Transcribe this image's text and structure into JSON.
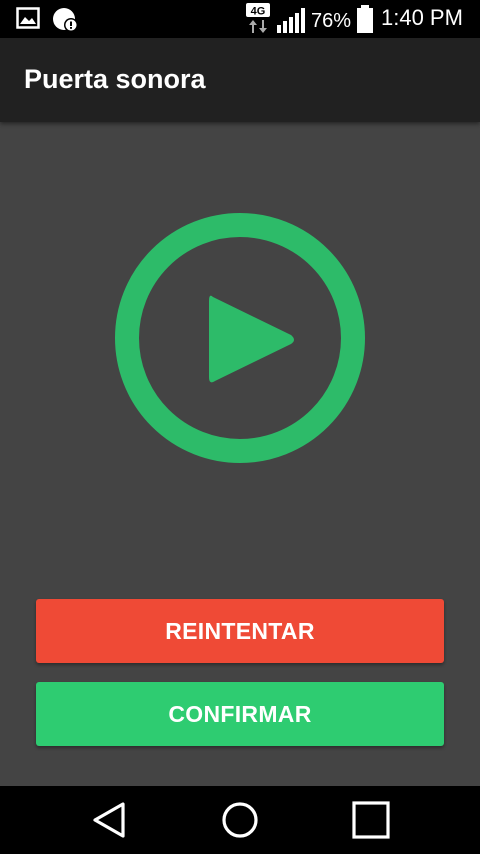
{
  "status_bar": {
    "network": "4G",
    "battery": "76%",
    "time": "1:40 PM",
    "icons": [
      "gallery-icon",
      "app-notification-icon",
      "network-4g-icon",
      "signal-icon",
      "battery-icon"
    ]
  },
  "app_bar": {
    "title": "Puerta sonora"
  },
  "player": {
    "icon": "play-icon",
    "accent_color": "#2dbb69"
  },
  "buttons": {
    "retry_label": "REINTENTAR",
    "confirm_label": "CONFIRMAR",
    "retry_color": "#ef4a36",
    "confirm_color": "#2ecc71"
  },
  "nav_bar": {
    "icons": [
      "back-icon",
      "home-icon",
      "recents-icon"
    ]
  }
}
